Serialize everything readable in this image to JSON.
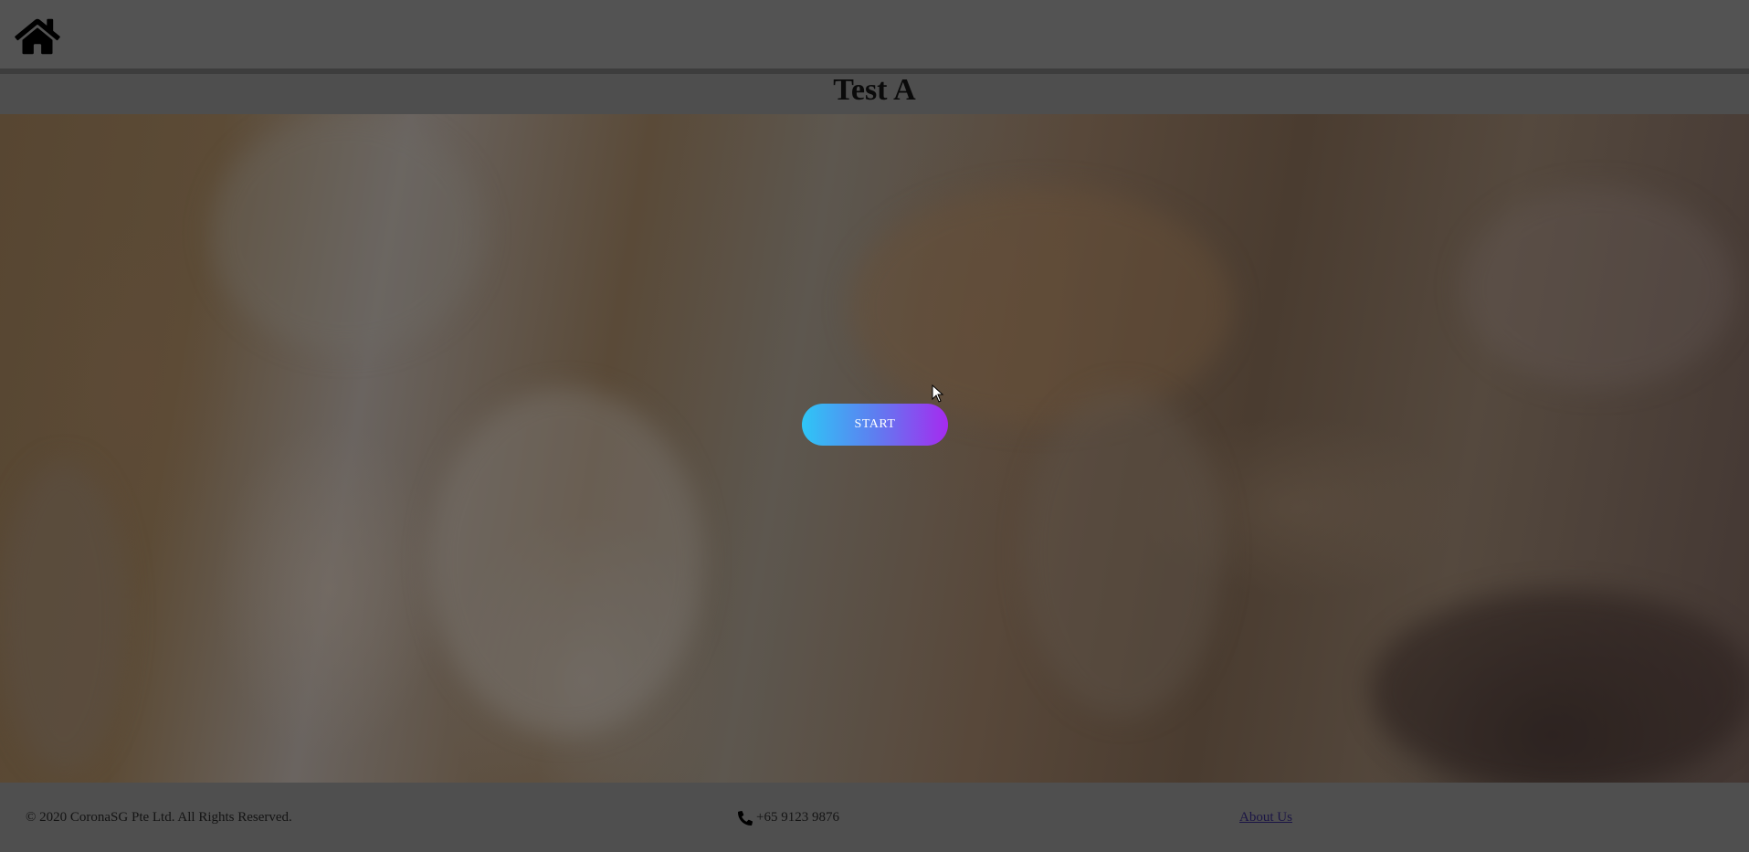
{
  "header": {
    "home_icon": "home-icon",
    "title": "Test A"
  },
  "main": {
    "start_label": "START",
    "start_gradient": [
      "#2ec6f6",
      "#a52bef"
    ]
  },
  "footer": {
    "copyright": "© 2020 CoronaSG Pte Ltd. All Rights Reserved.",
    "phone_icon": "phone-icon",
    "phone": "+65 9123 9876",
    "about_label": "About Us"
  },
  "colors": {
    "overlay_gray": "#4f4f4f",
    "title_text": "#0a0a0a",
    "link": "#1b1545"
  }
}
